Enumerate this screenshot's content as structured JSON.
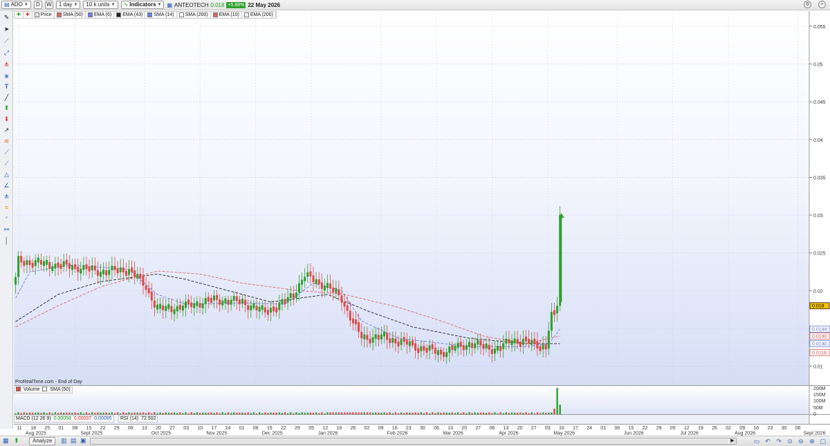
{
  "toolbar": {
    "ticker": "ADO",
    "mode_d": "D",
    "mode_w": "W",
    "timeframe": "1 day",
    "units": "10 k units",
    "indicators_label": "Indicators",
    "instrument_name": "ANTEOTECH",
    "last_price": "0.018",
    "change_pct": "+5.88%",
    "date": "22 May 2026"
  },
  "legend": [
    {
      "label": "Price",
      "color": "#e8e8e8"
    },
    {
      "label": "SMA (50)",
      "color": "#e06666"
    },
    {
      "label": "EMA (6)",
      "color": "#6d7fe0"
    },
    {
      "label": "EMA (43)",
      "color": "#222222"
    },
    {
      "label": "SMA (14)",
      "color": "#6d7fe0"
    },
    {
      "label": "SMA (200)",
      "color": "#ffffff"
    },
    {
      "label": "EMA (10)",
      "color": "#e06666"
    },
    {
      "label": "EMA (200)",
      "color": "#ffffff"
    }
  ],
  "source_label": "ProRealTime.com - End of Day",
  "volume_panel": {
    "label_volume": "Volume",
    "label_sma": "SMA (50)"
  },
  "indicator_panel": {
    "macd_label": "MACD (12 26 9)",
    "macd_v1": "0.00058",
    "macd_v2": "0.00037",
    "macd_v3": "0.00095",
    "rsi_label": "RSI (14)",
    "rsi_value": "72.502"
  },
  "bottom": {
    "analyze_label": "Analyze"
  },
  "colors": {
    "up": "#2ca02c",
    "down": "#e04848",
    "bg_top": "#ffffff",
    "bg_bottom": "#d8e0f6"
  },
  "chart_data": {
    "type": "candlestick",
    "title": "ANTEOTECH (ADO) daily",
    "y_ticks": [
      0.01,
      0.015,
      0.02,
      0.025,
      0.03,
      0.035,
      0.04,
      0.045,
      0.05,
      0.055
    ],
    "ylim": [
      0.0075,
      0.057
    ],
    "price_tags": [
      {
        "value": "0.018",
        "kind": "last"
      },
      {
        "value": "0.0149",
        "kind": "ema"
      },
      {
        "value": "0.0140",
        "kind": "sma"
      },
      {
        "value": "0.0130",
        "kind": "ema"
      },
      {
        "value": "0.0118",
        "kind": "sma"
      }
    ],
    "x_day_labels": [
      "11",
      "18",
      "25",
      "01",
      "08",
      "15",
      "22",
      "29",
      "06",
      "13",
      "20",
      "27",
      "03",
      "10",
      "17",
      "24",
      "01",
      "08",
      "15",
      "22",
      "29",
      "05",
      "12",
      "19",
      "26",
      "02",
      "09",
      "16",
      "23",
      "30",
      "06",
      "13",
      "20",
      "27",
      "06",
      "13",
      "20",
      "27",
      "03",
      "10",
      "17",
      "24",
      "01",
      "08",
      "15",
      "22",
      "29",
      "05",
      "12",
      "19",
      "26",
      "02",
      "09",
      "16",
      "23",
      "30",
      "06",
      "13",
      "20",
      "27",
      "04",
      "11",
      "18",
      "25",
      "01",
      "08",
      "15",
      "22",
      "29",
      "05",
      "12",
      "19",
      "26",
      "02",
      "09",
      "16",
      "23"
    ],
    "x_month_labels": [
      "Aug 2025",
      "Sept 2025",
      "Oct 2025",
      "Nov 2025",
      "Dec 2025",
      "Jan 2026",
      "Feb 2026",
      "Mar 2026",
      "Apr 2026",
      "May 2026",
      "Jun 2026",
      "Jul 2026",
      "Aug 2026",
      "Sept 2026"
    ],
    "x_month_anchor_day": [
      0,
      4,
      9,
      13,
      17,
      21,
      26,
      30,
      34,
      38,
      43,
      47,
      51,
      56
    ],
    "volume_ticks": [
      "200M",
      "150M",
      "100M",
      "50M",
      "0"
    ],
    "anchors": [
      {
        "x": 0,
        "close": 0.0215
      },
      {
        "x": 1,
        "close": 0.024
      },
      {
        "x": 10,
        "close": 0.0235
      },
      {
        "x": 20,
        "close": 0.0232
      },
      {
        "x": 30,
        "close": 0.0225
      },
      {
        "x": 40,
        "close": 0.0228
      },
      {
        "x": 46,
        "close": 0.0205
      },
      {
        "x": 50,
        "close": 0.0175
      },
      {
        "x": 58,
        "close": 0.0178
      },
      {
        "x": 70,
        "close": 0.0188
      },
      {
        "x": 80,
        "close": 0.0185
      },
      {
        "x": 87,
        "close": 0.0172
      },
      {
        "x": 94,
        "close": 0.0182
      },
      {
        "x": 98,
        "close": 0.0196
      },
      {
        "x": 102,
        "close": 0.022
      },
      {
        "x": 110,
        "close": 0.0205
      },
      {
        "x": 115,
        "close": 0.019
      },
      {
        "x": 118,
        "close": 0.0165
      },
      {
        "x": 122,
        "close": 0.0138
      },
      {
        "x": 130,
        "close": 0.0138
      },
      {
        "x": 136,
        "close": 0.0132
      },
      {
        "x": 142,
        "close": 0.0125
      },
      {
        "x": 150,
        "close": 0.0118
      },
      {
        "x": 160,
        "close": 0.013
      },
      {
        "x": 170,
        "close": 0.0122
      },
      {
        "x": 175,
        "close": 0.0135
      },
      {
        "x": 183,
        "close": 0.013
      },
      {
        "x": 187,
        "close": 0.0125
      },
      {
        "x": 189,
        "close": 0.0172
      },
      {
        "x": 190,
        "close": 0.017
      },
      {
        "x": 191,
        "close": 0.018
      },
      {
        "x": 192,
        "close": 0.03
      }
    ],
    "ma_lines": [
      {
        "name": "EMA (43)",
        "color": "#222222",
        "style": "dashed",
        "points": [
          [
            0,
            0.0159
          ],
          [
            15,
            0.0195
          ],
          [
            30,
            0.0212
          ],
          [
            50,
            0.0222
          ],
          [
            60,
            0.0215
          ],
          [
            70,
            0.0205
          ],
          [
            90,
            0.0185
          ],
          [
            110,
            0.0195
          ],
          [
            125,
            0.0172
          ],
          [
            140,
            0.0152
          ],
          [
            160,
            0.0137
          ],
          [
            180,
            0.013
          ],
          [
            192,
            0.013
          ]
        ]
      },
      {
        "name": "SMA (50)",
        "color": "#e06666",
        "style": "dashed",
        "points": [
          [
            0,
            0.0152
          ],
          [
            15,
            0.018
          ],
          [
            30,
            0.0205
          ],
          [
            50,
            0.0226
          ],
          [
            65,
            0.0222
          ],
          [
            80,
            0.021
          ],
          [
            100,
            0.02
          ],
          [
            115,
            0.0196
          ],
          [
            135,
            0.0178
          ],
          [
            150,
            0.016
          ],
          [
            165,
            0.014
          ],
          [
            180,
            0.013
          ],
          [
            192,
            0.014
          ]
        ]
      },
      {
        "name": "EMA (10)",
        "color": "#6d7fe0",
        "style": "dashed",
        "points": [
          [
            0,
            0.019
          ],
          [
            5,
            0.0225
          ],
          [
            20,
            0.0234
          ],
          [
            40,
            0.0228
          ],
          [
            50,
            0.0195
          ],
          [
            60,
            0.0182
          ],
          [
            80,
            0.0184
          ],
          [
            95,
            0.0182
          ],
          [
            105,
            0.021
          ],
          [
            115,
            0.02
          ],
          [
            122,
            0.016
          ],
          [
            135,
            0.0137
          ],
          [
            160,
            0.0126
          ],
          [
            180,
            0.0126
          ],
          [
            188,
            0.013
          ],
          [
            192,
            0.0149
          ]
        ]
      }
    ]
  }
}
